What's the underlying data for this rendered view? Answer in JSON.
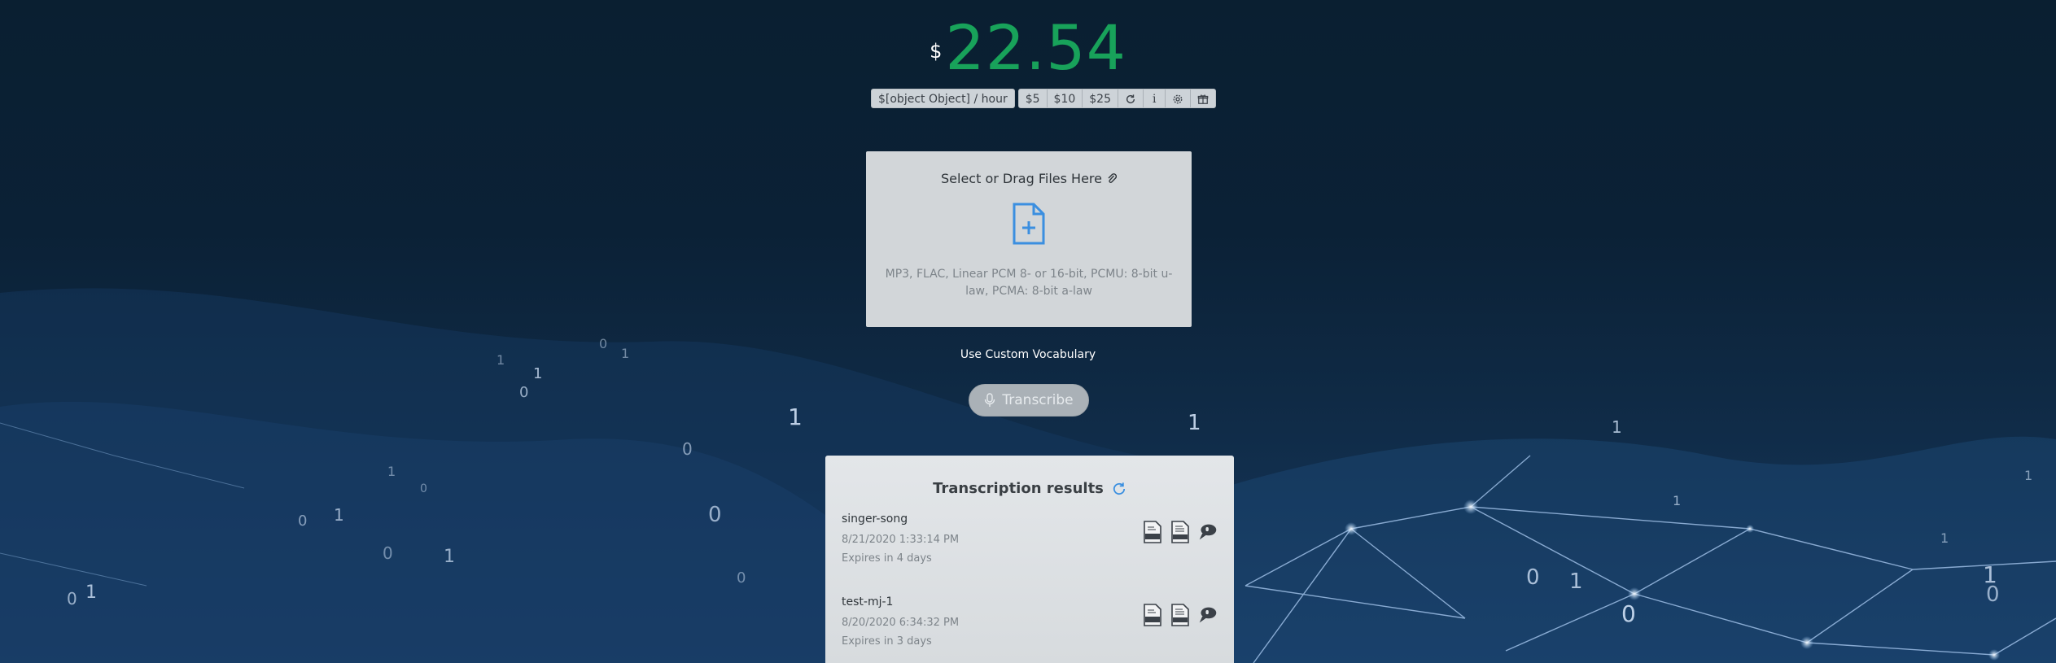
{
  "balance": {
    "currency_symbol": "$",
    "amount": "22.54"
  },
  "rate_label": "$[object Object] / hour",
  "topup": {
    "amounts": [
      "$5",
      "$10",
      "$25"
    ],
    "icons": [
      "refresh-icon",
      "info-icon",
      "settings-icon",
      "gift-icon"
    ],
    "info_glyph": "i"
  },
  "dropzone": {
    "title": "Select or Drag Files Here",
    "formats": "MP3, FLAC, Linear PCM 8- or 16-bit, PCMU: 8-bit u-law, PCMA: 8-bit a-law"
  },
  "custom_vocab_label": "Use Custom Vocabulary",
  "transcribe_label": "Transcribe",
  "results": {
    "title": "Transcription results",
    "items": [
      {
        "name": "singer-song",
        "date": "8/21/2020 1:33:14 PM",
        "expires": "Expires in 4 days",
        "actions": [
          "json-file-icon",
          "txt-file-icon",
          "audio-bubble-icon"
        ]
      },
      {
        "name": "test-mj-1",
        "date": "8/20/2020 6:34:32 PM",
        "expires": "Expires in 3 days",
        "actions": [
          "json-file-icon",
          "txt-file-icon",
          "audio-bubble-icon"
        ]
      }
    ]
  },
  "colors": {
    "amount": "#18a25a",
    "dropzone_icon": "#3b8fe0",
    "refresh_results": "#3b8fe0"
  }
}
